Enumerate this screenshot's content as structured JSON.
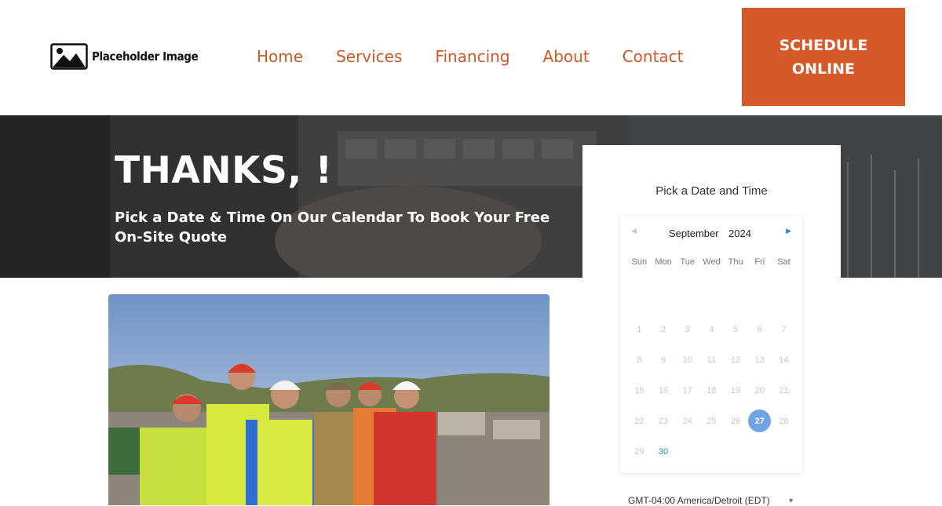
{
  "header": {
    "logo_text": "Placeholder Image",
    "nav": [
      {
        "label": "Home"
      },
      {
        "label": "Services"
      },
      {
        "label": "Financing"
      },
      {
        "label": "About"
      },
      {
        "label": "Contact"
      }
    ],
    "schedule_button": {
      "line1": "SCHEDULE",
      "line2": "ONLINE"
    }
  },
  "hero": {
    "title": "THANKS, !",
    "subtitle": "Pick a Date & Time On Our Calendar To Book Your Free On-Site Quote"
  },
  "calendar": {
    "heading": "Pick a Date and Time",
    "month": "September",
    "year": "2024",
    "prev_icon": "chevron-left-icon",
    "next_icon": "chevron-right-icon",
    "weekdays": [
      "Sun",
      "Mon",
      "Tue",
      "Wed",
      "Thu",
      "Fri",
      "Sat"
    ],
    "first_weekday_offset": 0,
    "days": [
      {
        "label": "1",
        "state": "disabled"
      },
      {
        "label": "2",
        "state": "disabled"
      },
      {
        "label": "3",
        "state": "disabled"
      },
      {
        "label": "4",
        "state": "disabled"
      },
      {
        "label": "5",
        "state": "disabled"
      },
      {
        "label": "6",
        "state": "disabled"
      },
      {
        "label": "7",
        "state": "disabled"
      },
      {
        "label": "8",
        "state": "disabled"
      },
      {
        "label": "9",
        "state": "disabled"
      },
      {
        "label": "10",
        "state": "disabled"
      },
      {
        "label": "11",
        "state": "disabled"
      },
      {
        "label": "12",
        "state": "disabled"
      },
      {
        "label": "13",
        "state": "disabled"
      },
      {
        "label": "14",
        "state": "disabled"
      },
      {
        "label": "15",
        "state": "disabled"
      },
      {
        "label": "16",
        "state": "disabled"
      },
      {
        "label": "17",
        "state": "disabled"
      },
      {
        "label": "18",
        "state": "disabled"
      },
      {
        "label": "19",
        "state": "disabled"
      },
      {
        "label": "20",
        "state": "disabled"
      },
      {
        "label": "21",
        "state": "disabled"
      },
      {
        "label": "22",
        "state": "disabled"
      },
      {
        "label": "23",
        "state": "disabled"
      },
      {
        "label": "24",
        "state": "disabled"
      },
      {
        "label": "25",
        "state": "disabled"
      },
      {
        "label": "26",
        "state": "disabled"
      },
      {
        "label": "27",
        "state": "selected"
      },
      {
        "label": "28",
        "state": "disabled"
      },
      {
        "label": "29",
        "state": "disabled"
      },
      {
        "label": "30",
        "state": "available"
      }
    ],
    "timezone": "GMT-04:00 America/Detroit (EDT)"
  },
  "colors": {
    "brand_orange": "#d45a2a",
    "nav_text": "#c95a2b",
    "calendar_accent": "#2f86c9",
    "calendar_selected": "#6fa3e6"
  }
}
